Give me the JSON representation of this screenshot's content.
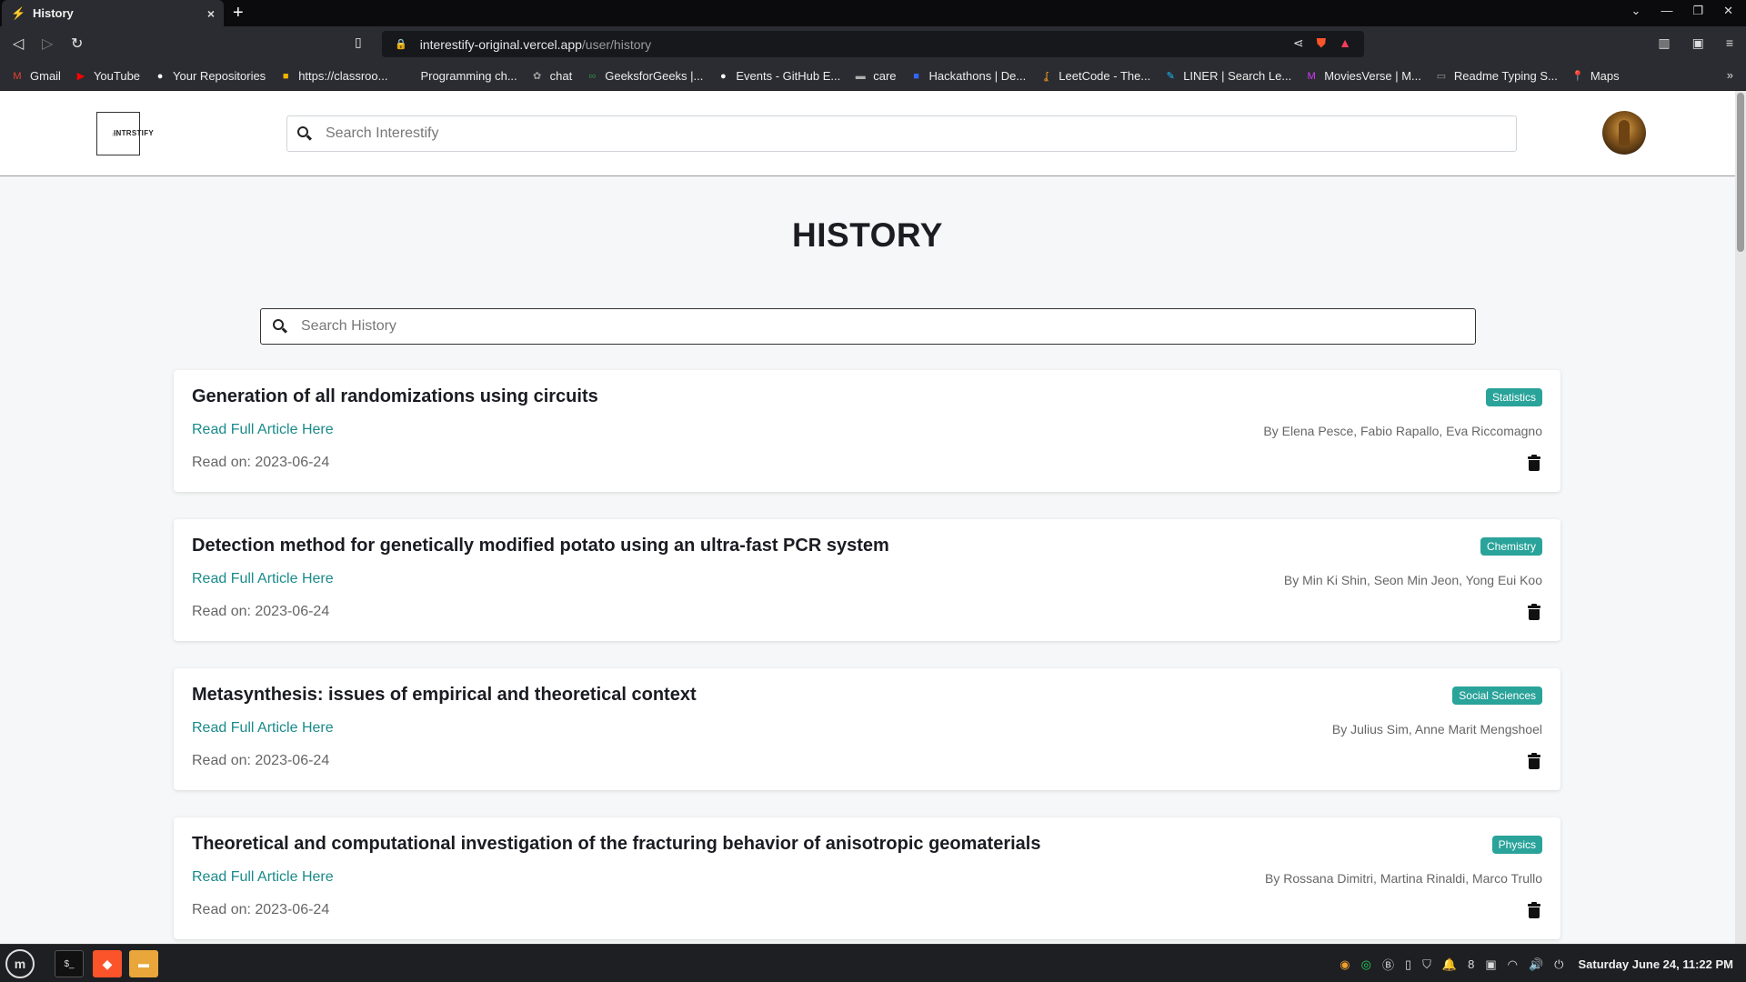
{
  "browser": {
    "tab_title": "History",
    "tab_close": "×",
    "new_tab": "+",
    "url_domain": "interestify-original.vercel.app",
    "url_path": "/user/history",
    "bookmarks": [
      {
        "label": "Gmail",
        "icon": "gmail-icon",
        "color": "#ea4335",
        "glyph": "M"
      },
      {
        "label": "YouTube",
        "icon": "youtube-icon",
        "color": "#ff0000",
        "glyph": "▶"
      },
      {
        "label": "Your Repositories",
        "icon": "github-icon",
        "color": "#ffffff",
        "glyph": "●"
      },
      {
        "label": "https://classroo...",
        "icon": "classroom-icon",
        "color": "#f4b400",
        "glyph": "■"
      },
      {
        "label": "Programming ch...",
        "icon": "page-icon",
        "color": "#2b2c31",
        "glyph": " "
      },
      {
        "label": "chat",
        "icon": "openai-icon",
        "color": "#a0a0a0",
        "glyph": "✿"
      },
      {
        "label": "GeeksforGeeks |...",
        "icon": "geeksforgeeks-icon",
        "color": "#2f8d46",
        "glyph": "∞"
      },
      {
        "label": "Events - GitHub E...",
        "icon": "github-icon",
        "color": "#ffffff",
        "glyph": "●"
      },
      {
        "label": "care",
        "icon": "folder-icon",
        "color": "#b0b0b0",
        "glyph": "▬"
      },
      {
        "label": "Hackathons | De...",
        "icon": "devpost-icon",
        "color": "#3367ff",
        "glyph": "■"
      },
      {
        "label": "LeetCode - The...",
        "icon": "leetcode-icon",
        "color": "#f89f1b",
        "glyph": "ʆ"
      },
      {
        "label": "LINER | Search Le...",
        "icon": "liner-icon",
        "color": "#14c1ff",
        "glyph": "✎"
      },
      {
        "label": "MoviesVerse | M...",
        "icon": "moviesverse-icon",
        "color": "#d63cff",
        "glyph": "M"
      },
      {
        "label": "Readme Typing S...",
        "icon": "keyboard-icon",
        "color": "#999999",
        "glyph": "▭"
      },
      {
        "label": "Maps",
        "icon": "maps-icon",
        "color": "#34a853",
        "glyph": "📍"
      }
    ],
    "bookmarks_more": "»"
  },
  "header": {
    "logo_text": "INTRSTIFY",
    "search_placeholder": "Search Interestify"
  },
  "main": {
    "title": "HISTORY",
    "search_placeholder": "Search History",
    "link_label": "Read Full Article Here",
    "articles": [
      {
        "title": "Generation of all randomizations using circuits",
        "category": "Statistics",
        "authors": "By Elena Pesce, Fabio Rapallo, Eva Riccomagno",
        "read_on": "Read on: 2023-06-24"
      },
      {
        "title": "Detection method for genetically modified potato using an ultra-fast PCR system",
        "category": "Chemistry",
        "authors": "By Min Ki Shin, Seon Min Jeon, Yong Eui Koo",
        "read_on": "Read on: 2023-06-24"
      },
      {
        "title": "Metasynthesis: issues of empirical and theoretical context",
        "category": "Social Sciences",
        "authors": "By Julius Sim, Anne Marit Mengshoel",
        "read_on": "Read on: 2023-06-24"
      },
      {
        "title": "Theoretical and computational investigation of the fracturing behavior of anisotropic geomaterials",
        "category": "Physics",
        "authors": "By Rossana Dimitri, Martina Rinaldi, Marco Trullo",
        "read_on": "Read on: 2023-06-24"
      }
    ]
  },
  "taskbar": {
    "notification_count": "8",
    "clock": "Saturday June 24, 11:22 PM"
  },
  "colors": {
    "accent_link": "#1a8a8a",
    "badge": "#2aa39a"
  }
}
